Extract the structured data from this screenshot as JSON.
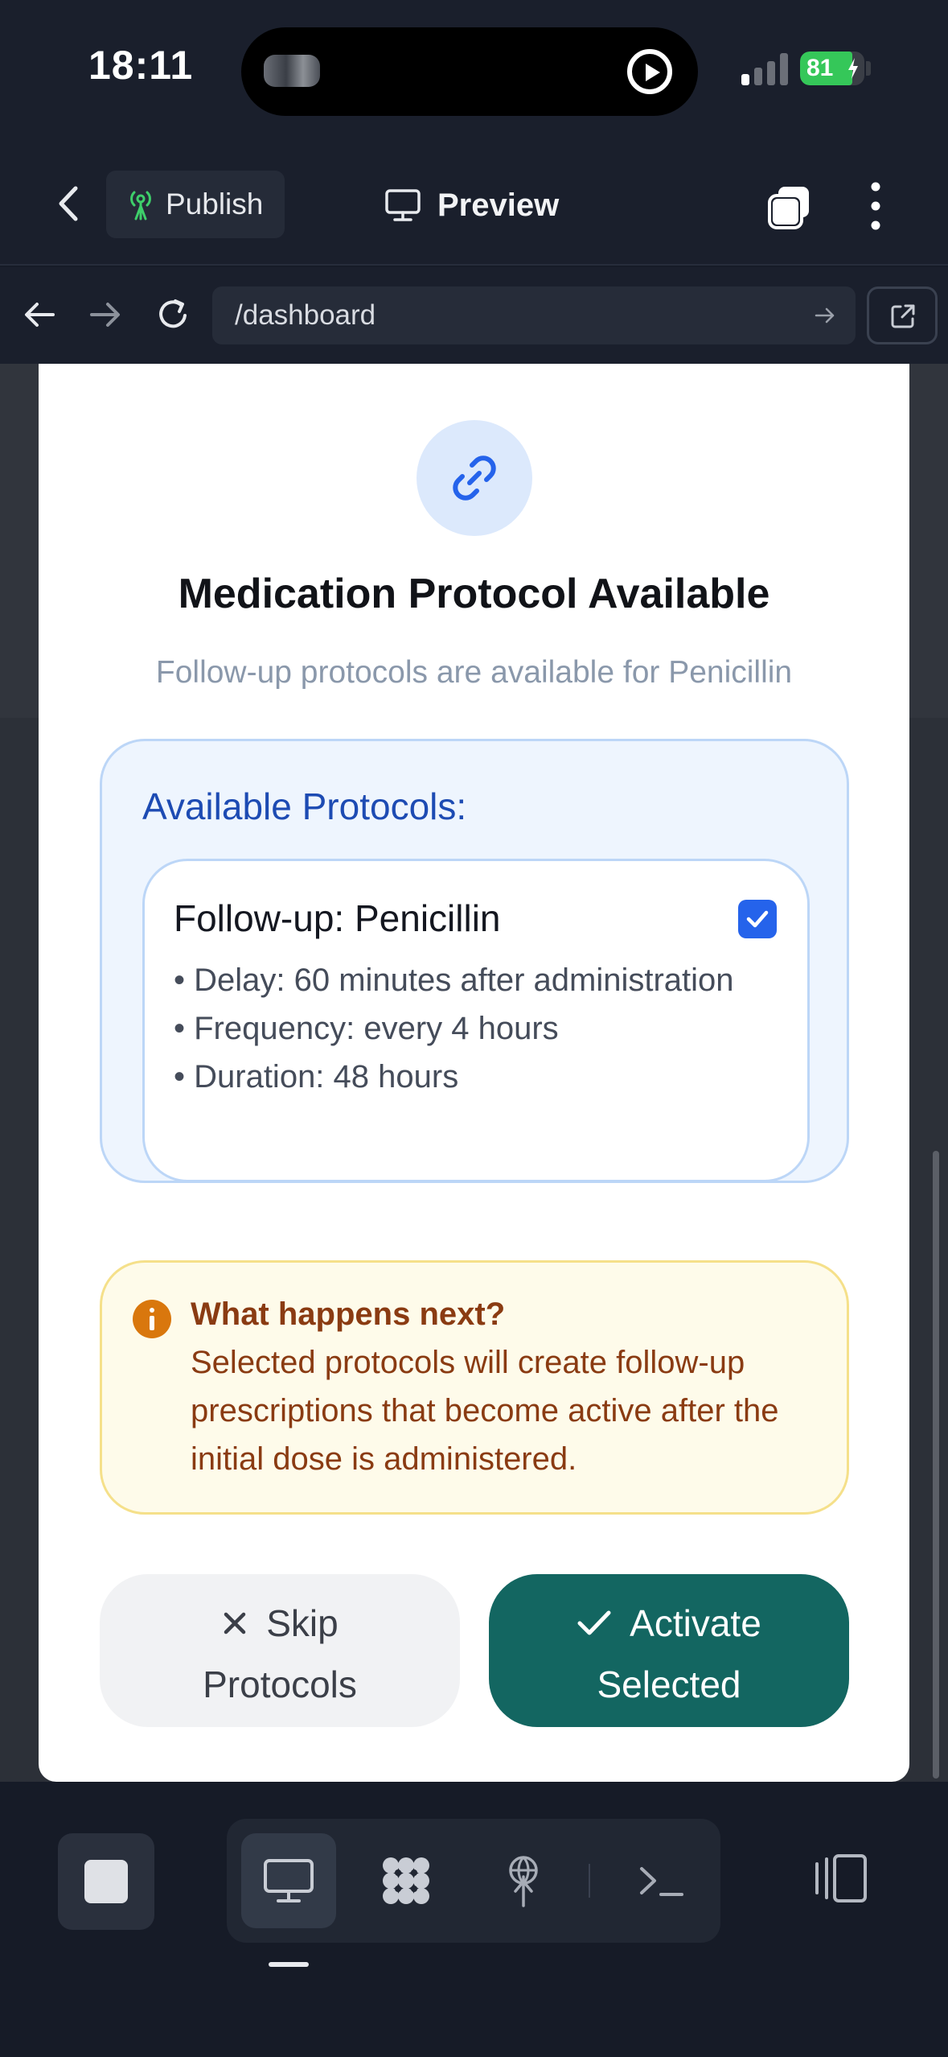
{
  "status_bar": {
    "time": "18:11",
    "battery": "81",
    "battery_level_percent": 81
  },
  "app_bar": {
    "back_icon": "chevron-left-icon",
    "publish_label": "Publish",
    "publish_icon": "broadcast-tower-icon",
    "preview_label": "Preview",
    "preview_icon": "monitor-icon",
    "tabs_icon": "tabs-icon",
    "more_icon": "kebab-menu-icon"
  },
  "url_bar": {
    "url": "/dashboard",
    "icons": [
      "arrow-left-icon",
      "arrow-right-icon",
      "reload-icon",
      "go-arrow-icon",
      "external-link-icon"
    ]
  },
  "modal": {
    "icon": "link-icon",
    "title": "Medication Protocol Available",
    "subtitle": "Follow-up protocols are available for Penicillin",
    "protocols_heading": "Available Protocols:",
    "protocol": {
      "name": "Follow-up: Penicillin",
      "checked": true,
      "delay": "• Delay: 60 minutes after administration",
      "frequency": "• Frequency: every 4 hours",
      "duration": "• Duration: 48 hours"
    },
    "info": {
      "title": "What happens next?",
      "text": "Selected protocols will create follow-up prescriptions that become active after the initial dose is administered."
    },
    "skip_line1": "Skip",
    "skip_line2": "Protocols",
    "activate_line1": "Activate",
    "activate_line2": "Selected"
  },
  "bottom_bar": {
    "icons": [
      "stop-icon",
      "desktop-icon",
      "apps-grid-icon",
      "broadcast-tower-icon",
      "terminal-icon",
      "side-panel-icon"
    ]
  },
  "colors": {
    "accent_blue": "#2563eb",
    "activate_teal": "#136661",
    "warning_text": "#8a3b12",
    "heading_blue": "#1d4bb3"
  }
}
